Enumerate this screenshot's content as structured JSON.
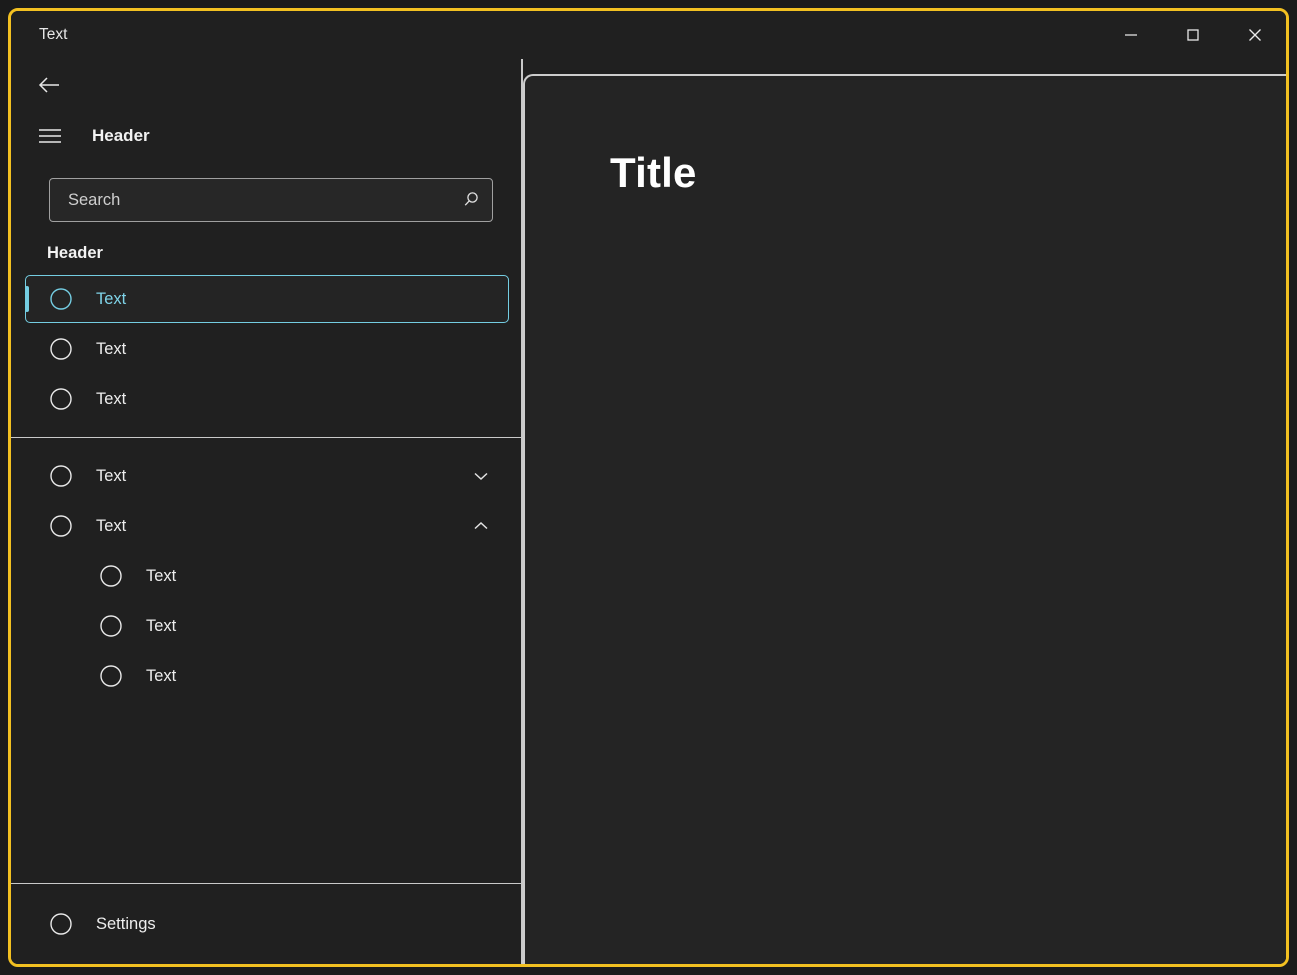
{
  "window": {
    "title": "Text",
    "accent_border_color": "#f2c021",
    "background_color": "#202020",
    "controls": {
      "minimize_label": "Minimize",
      "maximize_label": "Maximize",
      "close_label": "Close"
    }
  },
  "nav": {
    "back_label": "Back",
    "menu_toggle_label": "Menu",
    "menu_header": "Header",
    "selection_color": "#74cde2",
    "search": {
      "value": "",
      "placeholder": "Search",
      "icon": "search-icon"
    },
    "group_header": "Header",
    "items": [
      {
        "label": "Text",
        "icon": "circle-icon",
        "selected": true,
        "expandable": false,
        "level": 0
      },
      {
        "label": "Text",
        "icon": "circle-icon",
        "selected": false,
        "expandable": false,
        "level": 0
      },
      {
        "label": "Text",
        "icon": "circle-icon",
        "selected": false,
        "expandable": false,
        "level": 0
      }
    ],
    "expandable_items": [
      {
        "label": "Text",
        "icon": "circle-icon",
        "chevron": "chevron-down-icon",
        "expanded": false,
        "level": 0
      },
      {
        "label": "Text",
        "icon": "circle-icon",
        "chevron": "chevron-up-icon",
        "expanded": true,
        "level": 0
      }
    ],
    "children": [
      {
        "label": "Text",
        "icon": "circle-icon",
        "level": 1
      },
      {
        "label": "Text",
        "icon": "circle-icon",
        "level": 1
      },
      {
        "label": "Text",
        "icon": "circle-icon",
        "level": 1
      }
    ],
    "footer": {
      "label": "Settings",
      "icon": "circle-icon"
    }
  },
  "content": {
    "title": "Title"
  }
}
